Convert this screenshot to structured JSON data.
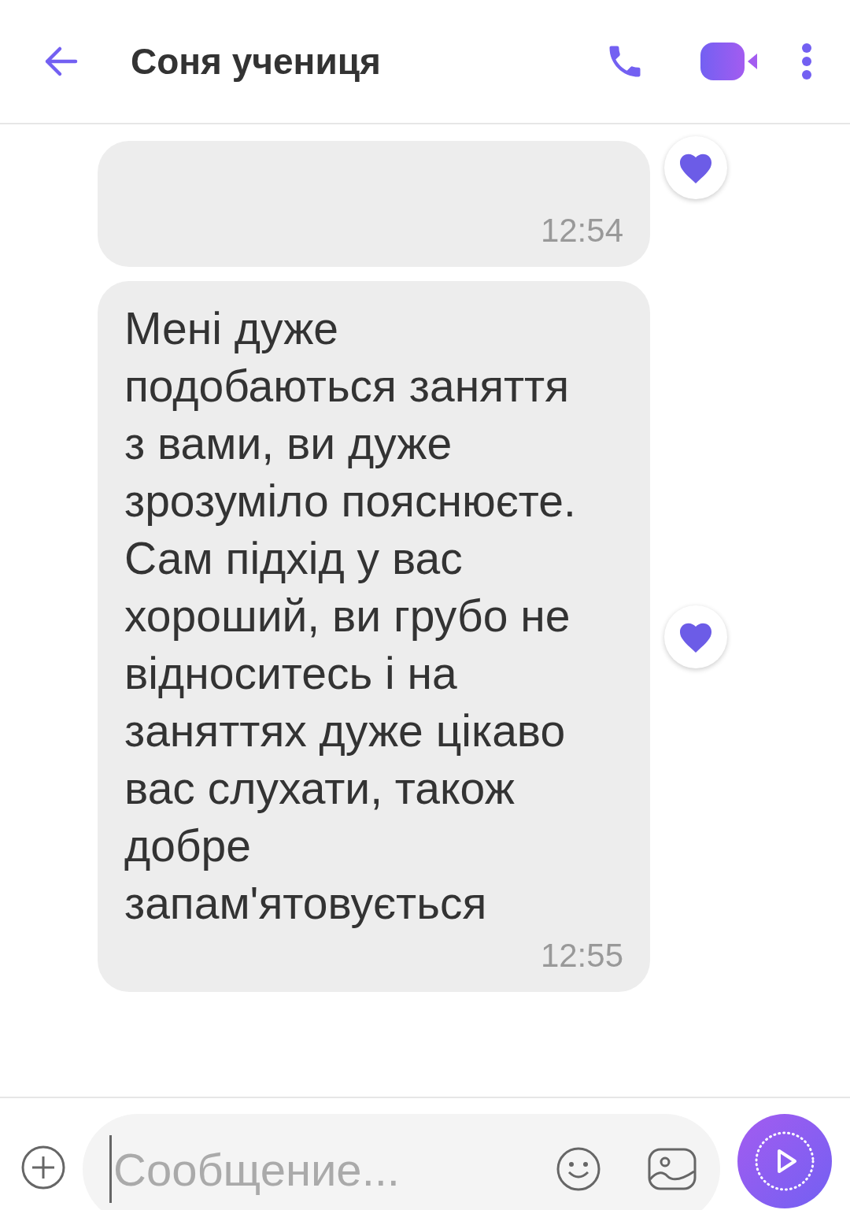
{
  "header": {
    "title": "Соня учениця"
  },
  "messages": [
    {
      "time": "12:54",
      "liked": true
    },
    {
      "text": "Мені дуже подобаються заняття з вами, ви дуже зрозуміло пояснюєте. Сам підхід у вас хороший, ви грубо не відноситесь і на заняттях дуже цікаво вас слухати, також добре запам'ятовується",
      "time": "12:55",
      "liked": true
    }
  ],
  "composer": {
    "placeholder": "Сообщение..."
  }
}
